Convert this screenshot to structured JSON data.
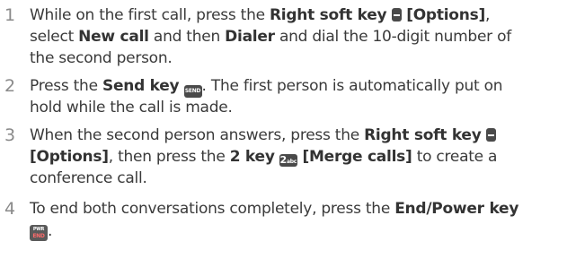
{
  "steps": [
    {
      "number": "1",
      "line1_a": "While on the first call, press the ",
      "line1_key": "Right soft key",
      "line1_options": " [Options]",
      "line1_end": ",",
      "line2_a": "select ",
      "line2_newcall": "New call",
      "line2_b": " and then ",
      "line2_dialer": "Dialer",
      "line2_c": " and dial the 10-digit number of",
      "line3": "the second person."
    },
    {
      "number": "2",
      "line1_a": "Press the ",
      "line1_key": "Send key",
      "line1_b": ". The first person is automatically put on",
      "send_icon_text": "SEND",
      "line2": "hold while the call is made."
    },
    {
      "number": "3",
      "line1_a": "When the second person answers, press the ",
      "line1_key": "Right soft key",
      "line2_options": "[Options]",
      "line2_a": ", then press the ",
      "line2_key": "2 key",
      "line2_merge": " [Merge calls]",
      "line2_b": " to create a",
      "two_icon_digit": "2",
      "two_icon_letters": "abc",
      "line3": "conference call."
    },
    {
      "number": "4",
      "line1_a": "To end both conversations completely, press the ",
      "line1_key": "End/Power key",
      "end_icon_top": "PWR",
      "end_icon_bottom": "END",
      "line2_end": "."
    }
  ],
  "colors": {
    "text": "#3a3a3a",
    "step_number": "#8a8a8a",
    "key_icon": "#4a4a4a",
    "end_label": "#ff6b6b"
  }
}
